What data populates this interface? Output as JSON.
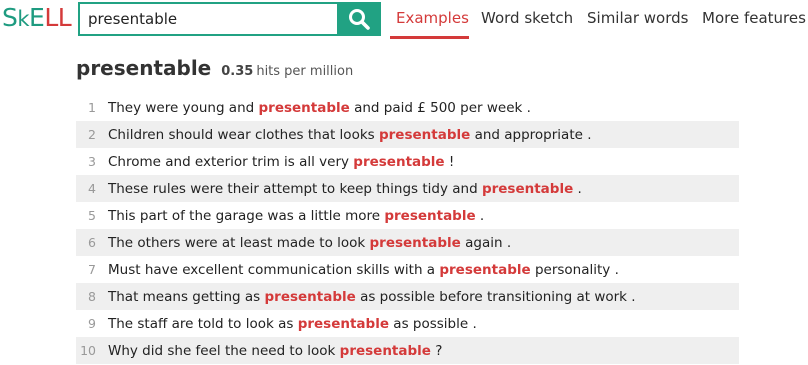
{
  "logo": {
    "p1": "S",
    "p2": "k",
    "p3": "E",
    "p4": "LL"
  },
  "search": {
    "value": "presentable",
    "placeholder": ""
  },
  "nav": {
    "examples": "Examples",
    "word_sketch": "Word sketch",
    "similar_words": "Similar words",
    "more_features": "More features"
  },
  "result": {
    "word": "presentable",
    "frequency": "0.35",
    "frequency_unit": "hits per million"
  },
  "examples": [
    {
      "num": "1",
      "before": "They were young and ",
      "kw": "presentable",
      "after": " and paid £ 500 per week ."
    },
    {
      "num": "2",
      "before": "Children should wear clothes that looks ",
      "kw": "presentable",
      "after": " and appropriate ."
    },
    {
      "num": "3",
      "before": "Chrome and exterior trim is all very ",
      "kw": "presentable",
      "after": " !"
    },
    {
      "num": "4",
      "before": "These rules were their attempt to keep things tidy and ",
      "kw": "presentable",
      "after": " ."
    },
    {
      "num": "5",
      "before": "This part of the garage was a little more ",
      "kw": "presentable",
      "after": " ."
    },
    {
      "num": "6",
      "before": "The others were at least made to look ",
      "kw": "presentable",
      "after": " again ."
    },
    {
      "num": "7",
      "before": "Must have excellent communication skills with a ",
      "kw": "presentable",
      "after": " personality ."
    },
    {
      "num": "8",
      "before": "That means getting as ",
      "kw": "presentable",
      "after": " as possible before transitioning at work ."
    },
    {
      "num": "9",
      "before": "The staff are told to look as ",
      "kw": "presentable",
      "after": " as possible ."
    },
    {
      "num": "10",
      "before": "Why did she feel the need to look ",
      "kw": "presentable",
      "after": " ?"
    }
  ],
  "colors": {
    "accent_green": "#21a283",
    "accent_red": "#d43a3a",
    "row_shade": "#efefef"
  },
  "icons": {
    "search": "magnifier-icon"
  }
}
